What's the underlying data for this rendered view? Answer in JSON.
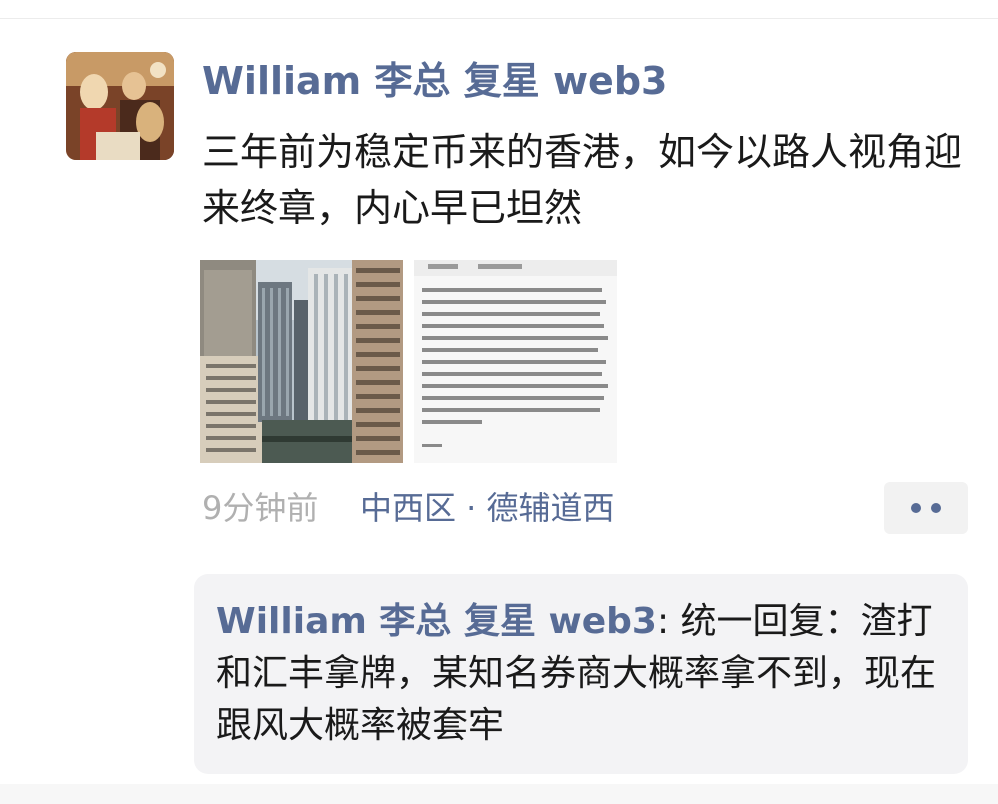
{
  "post": {
    "author": "William 李总 复星 web3",
    "text": "三年前为稳定币来的香港，如今以路人视角迎来终章，内心早已坦然",
    "time": "9分钟前",
    "location": "中西区 · 德辅道西"
  },
  "images": [
    {
      "icon": "city-buildings-photo"
    },
    {
      "icon": "news-screenshot-thumbnail"
    }
  ],
  "comment": {
    "author": "William 李总 复星 web3",
    "separator": ": ",
    "text": "统一回复：渣打和汇丰拿牌，某知名券商大概率拿不到，现在跟风大概率被套牢"
  },
  "colors": {
    "link": "#576b95",
    "text": "#1a1a1a",
    "meta": "#b0b0b0",
    "comment_bg": "#f3f3f5"
  }
}
